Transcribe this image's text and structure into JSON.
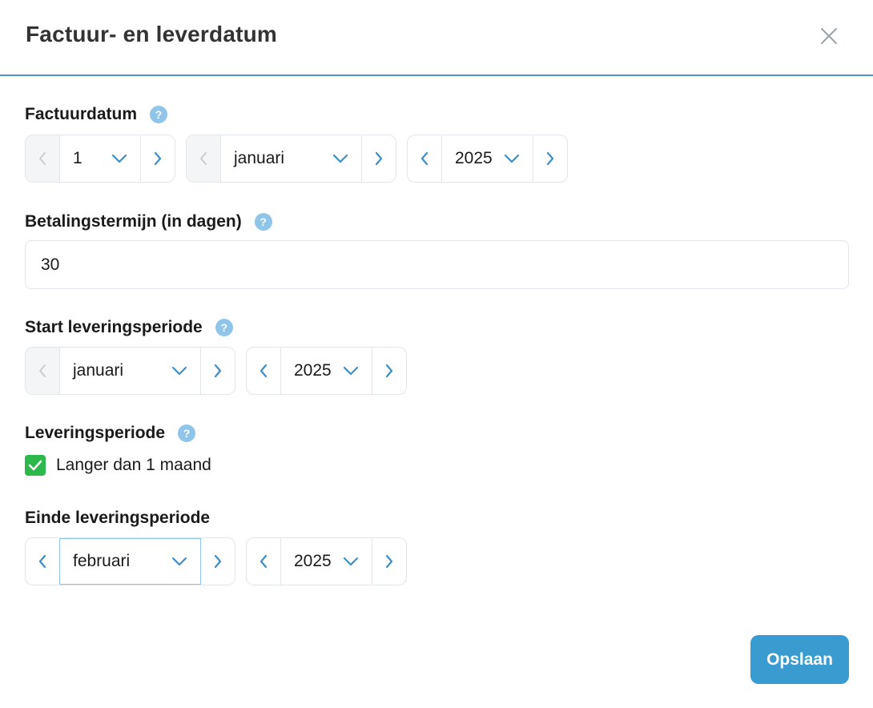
{
  "dialog": {
    "title": "Factuur- en leverdatum",
    "close_icon": "close-icon"
  },
  "invoice_date": {
    "label": "Factuurdatum",
    "help": "?",
    "day": "1",
    "month": "januari",
    "year": "2025"
  },
  "payment_term": {
    "label": "Betalingstermijn (in dagen)",
    "help": "?",
    "value": "30"
  },
  "delivery_start": {
    "label": "Start leveringsperiode",
    "help": "?",
    "month": "januari",
    "year": "2025"
  },
  "delivery_period": {
    "label": "Leveringsperiode",
    "help": "?",
    "checkbox_label": "Langer dan 1 maand",
    "checked": true
  },
  "delivery_end": {
    "label": "Einde leveringsperiode",
    "month": "februari",
    "year": "2025"
  },
  "footer": {
    "save_label": "Opslaan"
  },
  "colors": {
    "accent": "#3a9bd0",
    "help_badge": "#8ec5e8",
    "check_green": "#2db84b",
    "arrow_active": "#3a8fc8",
    "arrow_disabled": "#c8cdd2"
  }
}
